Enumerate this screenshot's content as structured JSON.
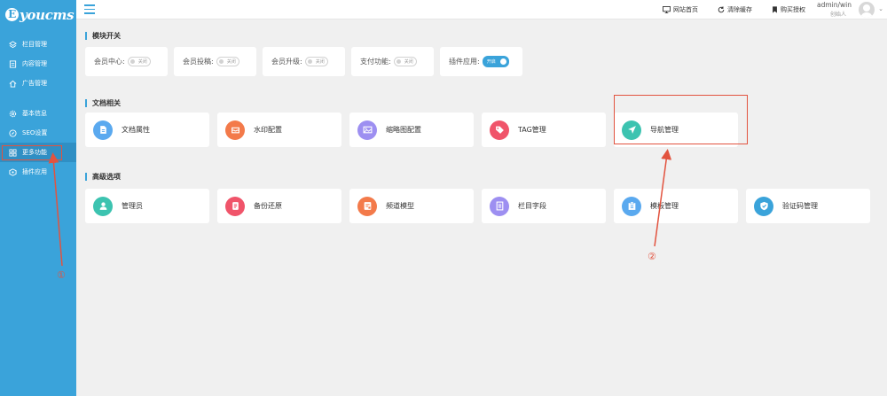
{
  "brand": {
    "logo_letter": "E",
    "logo_text": "youcms"
  },
  "sidebar": {
    "items": [
      {
        "label": "栏目管理",
        "icon": "layers-icon"
      },
      {
        "label": "内容管理",
        "icon": "document-icon"
      },
      {
        "label": "广告管理",
        "icon": "home-icon"
      },
      {
        "label": "基本信息",
        "icon": "gear-icon"
      },
      {
        "label": "SEO设置",
        "icon": "compass-icon"
      },
      {
        "label": "更多功能",
        "icon": "grid-icon",
        "active": true
      },
      {
        "label": "插件应用",
        "icon": "plugin-icon"
      }
    ]
  },
  "topbar": {
    "links": [
      {
        "label": "网站首页",
        "icon": "monitor-icon"
      },
      {
        "label": "清除缓存",
        "icon": "refresh-icon"
      },
      {
        "label": "购买授权",
        "icon": "bookmark-icon"
      }
    ],
    "user": {
      "name": "admin/win",
      "role": "创始人"
    }
  },
  "sections": {
    "modules": "模块开关",
    "docs": "文档相关",
    "advanced": "高级选项"
  },
  "switches": [
    {
      "label": "会员中心:",
      "state": "关闭",
      "on": false
    },
    {
      "label": "会员投稿:",
      "state": "关闭",
      "on": false
    },
    {
      "label": "会员升级:",
      "state": "关闭",
      "on": false
    },
    {
      "label": "支付功能:",
      "state": "关闭",
      "on": false
    },
    {
      "label": "插件应用:",
      "state": "开启",
      "on": true
    }
  ],
  "doc_cards": [
    {
      "label": "文档属性",
      "icon": "file-icon",
      "color": "#5aa9ef"
    },
    {
      "label": "水印配置",
      "icon": "watermark-icon",
      "color": "#f37a4a"
    },
    {
      "label": "缩略图配置",
      "icon": "image-icon",
      "color": "#9d8ff1"
    },
    {
      "label": "TAG管理",
      "icon": "tag-icon",
      "color": "#f0546a"
    },
    {
      "label": "导航管理",
      "icon": "navigation-icon",
      "color": "#3cc3b0"
    }
  ],
  "adv_cards": [
    {
      "label": "管理员",
      "icon": "admin-user-icon",
      "color": "#3cc3b0"
    },
    {
      "label": "备份还原",
      "icon": "backup-icon",
      "color": "#f0546a"
    },
    {
      "label": "频道模型",
      "icon": "model-icon",
      "color": "#f37a4a"
    },
    {
      "label": "栏目字段",
      "icon": "field-list-icon",
      "color": "#9d8ff1"
    },
    {
      "label": "模板管理",
      "icon": "template-icon",
      "color": "#5aa9ef"
    },
    {
      "label": "验证码管理",
      "icon": "shield-check-icon",
      "color": "#3aa3da"
    }
  ],
  "annotations": {
    "marker_1": "①",
    "marker_2": "②"
  },
  "colors": {
    "sidebar": "#3aa3da",
    "accent": "#3aa3da",
    "annotation": "#e2533f"
  }
}
